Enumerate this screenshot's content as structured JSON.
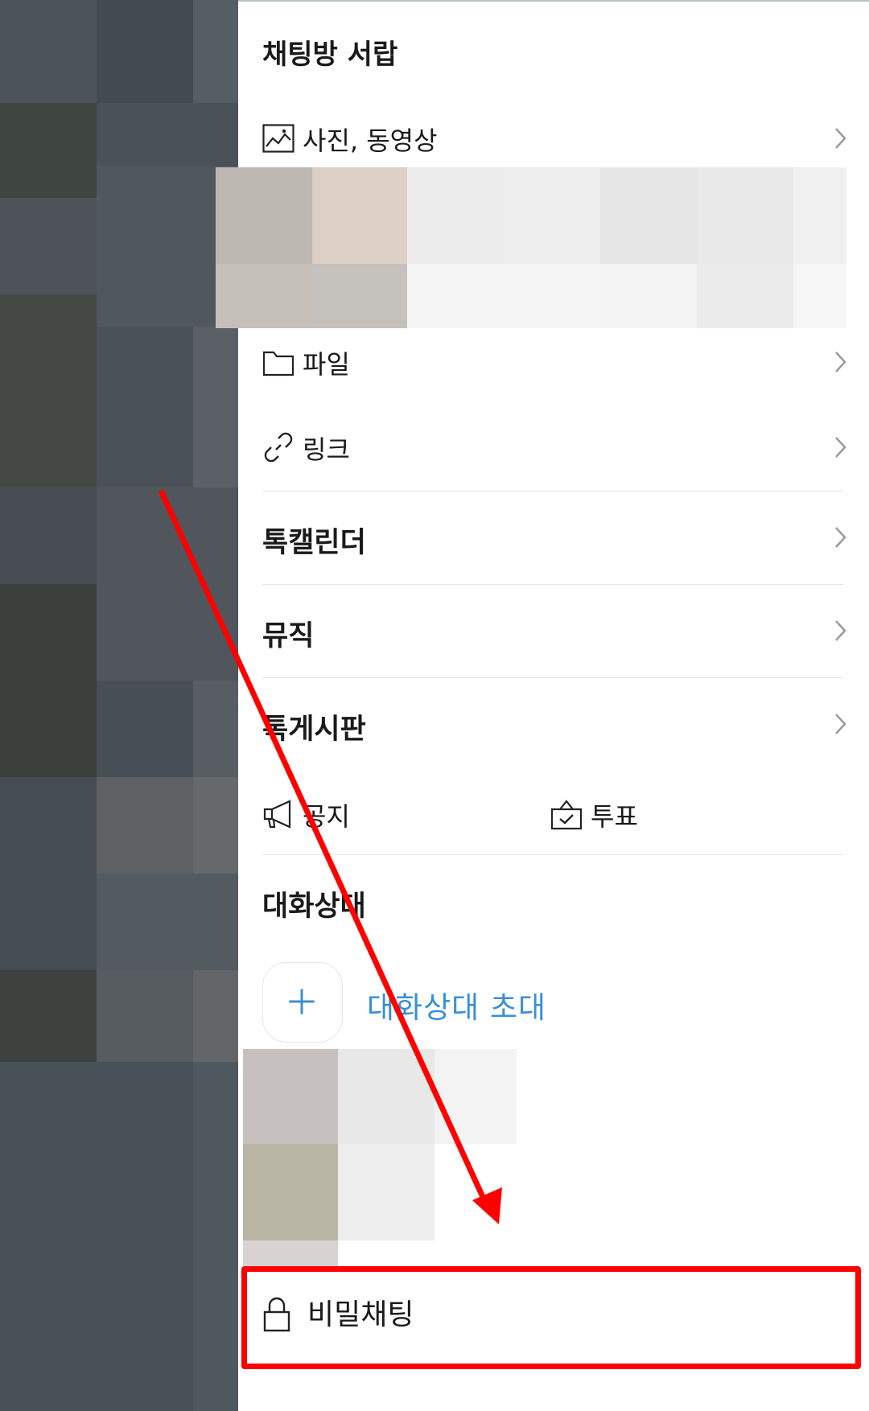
{
  "drawer": {
    "title": "채팅방 서랍",
    "media": {
      "label": "사진, 동영상",
      "icon": "image-icon"
    },
    "files": {
      "label": "파일",
      "icon": "folder-icon"
    },
    "links": {
      "label": "링크",
      "icon": "link-icon"
    },
    "sections": [
      {
        "label": "톡캘린더"
      },
      {
        "label": "뮤직"
      },
      {
        "label": "톡게시판"
      }
    ],
    "notice": {
      "label": "공지",
      "icon": "megaphone-icon"
    },
    "vote": {
      "label": "투표",
      "icon": "ballot-box-icon"
    }
  },
  "members": {
    "heading": "대화상대",
    "invite_label": "대화상대 초대",
    "invite_icon": "plus-icon"
  },
  "secret_chat": {
    "label": "비밀채팅",
    "icon": "lock-icon"
  },
  "colors": {
    "accent_blue": "#3a8fd6",
    "highlight_red": "#ff0000",
    "overlay_gray": "#4a525a"
  }
}
